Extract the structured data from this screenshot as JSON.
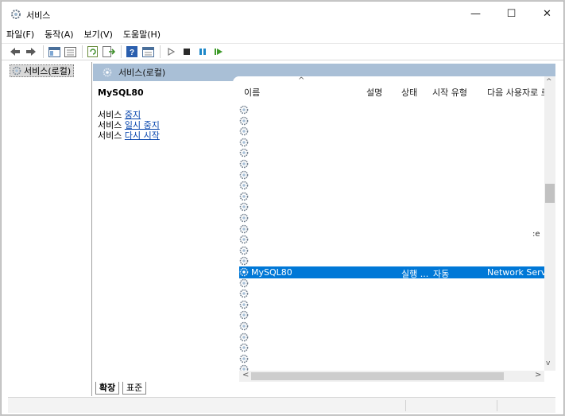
{
  "window": {
    "title": "서비스",
    "minimize_glyph": "—",
    "maximize_glyph": "☐",
    "close_glyph": "✕"
  },
  "menu": [
    "파일(F)",
    "동작(A)",
    "보기(V)",
    "도움말(H)"
  ],
  "toolbar": {
    "icons": [
      "back-icon",
      "forward-icon",
      "show-hide-tree-icon",
      "properties-icon",
      "refresh-icon",
      "export-list-icon",
      "help-icon",
      "console-view-icon",
      "start-service-icon",
      "stop-service-icon",
      "pause-service-icon",
      "resume-service-icon"
    ]
  },
  "tree": {
    "item_label": "서비스(로컬)"
  },
  "pane": {
    "header_title": "서비스(로컬)"
  },
  "description": {
    "service_name": "MySQL80",
    "prefix": "서비스",
    "actions": [
      "중지",
      "일시 중지",
      "다시 시작"
    ]
  },
  "columns": {
    "name": "이름",
    "description": "설명",
    "status": "상태",
    "startup_type": "시작 유형",
    "log_on_as": "다음 사용자로 로"
  },
  "selected_service": {
    "name": "MySQL80",
    "status": "실행 ...",
    "startup_type": "자동",
    "log_on_as": "Network Service"
  },
  "partial_text": ":e",
  "tabs": {
    "extended": "확장",
    "standard": "표준"
  },
  "scroll": {
    "up": "^",
    "down": "v",
    "left": "<",
    "right": ">"
  },
  "colors": {
    "selection": "#0078d7",
    "pane_header": "#a9bfd6",
    "link": "#0645ad"
  }
}
